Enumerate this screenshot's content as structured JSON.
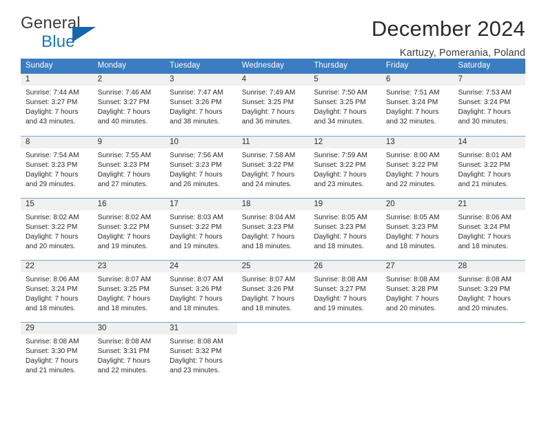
{
  "brand": {
    "name_part1": "General",
    "name_part2": "Blue",
    "triangle_color": "#1566ac",
    "blue_color": "#1878be"
  },
  "header": {
    "title": "December 2024",
    "subtitle": "Kartuzy, Pomerania, Poland"
  },
  "calendar": {
    "header_bg": "#3b7dc0",
    "header_text_color": "#ffffff",
    "daynumber_band_bg": "#f0f0f0",
    "row_separator_color": "#7aa3cf",
    "weekdays": [
      "Sunday",
      "Monday",
      "Tuesday",
      "Wednesday",
      "Thursday",
      "Friday",
      "Saturday"
    ],
    "weeks": [
      [
        {
          "day": "1",
          "sunrise": "Sunrise: 7:44 AM",
          "sunset": "Sunset: 3:27 PM",
          "daylight_line1": "Daylight: 7 hours",
          "daylight_line2": "and 43 minutes."
        },
        {
          "day": "2",
          "sunrise": "Sunrise: 7:46 AM",
          "sunset": "Sunset: 3:27 PM",
          "daylight_line1": "Daylight: 7 hours",
          "daylight_line2": "and 40 minutes."
        },
        {
          "day": "3",
          "sunrise": "Sunrise: 7:47 AM",
          "sunset": "Sunset: 3:26 PM",
          "daylight_line1": "Daylight: 7 hours",
          "daylight_line2": "and 38 minutes."
        },
        {
          "day": "4",
          "sunrise": "Sunrise: 7:49 AM",
          "sunset": "Sunset: 3:25 PM",
          "daylight_line1": "Daylight: 7 hours",
          "daylight_line2": "and 36 minutes."
        },
        {
          "day": "5",
          "sunrise": "Sunrise: 7:50 AM",
          "sunset": "Sunset: 3:25 PM",
          "daylight_line1": "Daylight: 7 hours",
          "daylight_line2": "and 34 minutes."
        },
        {
          "day": "6",
          "sunrise": "Sunrise: 7:51 AM",
          "sunset": "Sunset: 3:24 PM",
          "daylight_line1": "Daylight: 7 hours",
          "daylight_line2": "and 32 minutes."
        },
        {
          "day": "7",
          "sunrise": "Sunrise: 7:53 AM",
          "sunset": "Sunset: 3:24 PM",
          "daylight_line1": "Daylight: 7 hours",
          "daylight_line2": "and 30 minutes."
        }
      ],
      [
        {
          "day": "8",
          "sunrise": "Sunrise: 7:54 AM",
          "sunset": "Sunset: 3:23 PM",
          "daylight_line1": "Daylight: 7 hours",
          "daylight_line2": "and 29 minutes."
        },
        {
          "day": "9",
          "sunrise": "Sunrise: 7:55 AM",
          "sunset": "Sunset: 3:23 PM",
          "daylight_line1": "Daylight: 7 hours",
          "daylight_line2": "and 27 minutes."
        },
        {
          "day": "10",
          "sunrise": "Sunrise: 7:56 AM",
          "sunset": "Sunset: 3:23 PM",
          "daylight_line1": "Daylight: 7 hours",
          "daylight_line2": "and 26 minutes."
        },
        {
          "day": "11",
          "sunrise": "Sunrise: 7:58 AM",
          "sunset": "Sunset: 3:22 PM",
          "daylight_line1": "Daylight: 7 hours",
          "daylight_line2": "and 24 minutes."
        },
        {
          "day": "12",
          "sunrise": "Sunrise: 7:59 AM",
          "sunset": "Sunset: 3:22 PM",
          "daylight_line1": "Daylight: 7 hours",
          "daylight_line2": "and 23 minutes."
        },
        {
          "day": "13",
          "sunrise": "Sunrise: 8:00 AM",
          "sunset": "Sunset: 3:22 PM",
          "daylight_line1": "Daylight: 7 hours",
          "daylight_line2": "and 22 minutes."
        },
        {
          "day": "14",
          "sunrise": "Sunrise: 8:01 AM",
          "sunset": "Sunset: 3:22 PM",
          "daylight_line1": "Daylight: 7 hours",
          "daylight_line2": "and 21 minutes."
        }
      ],
      [
        {
          "day": "15",
          "sunrise": "Sunrise: 8:02 AM",
          "sunset": "Sunset: 3:22 PM",
          "daylight_line1": "Daylight: 7 hours",
          "daylight_line2": "and 20 minutes."
        },
        {
          "day": "16",
          "sunrise": "Sunrise: 8:02 AM",
          "sunset": "Sunset: 3:22 PM",
          "daylight_line1": "Daylight: 7 hours",
          "daylight_line2": "and 19 minutes."
        },
        {
          "day": "17",
          "sunrise": "Sunrise: 8:03 AM",
          "sunset": "Sunset: 3:22 PM",
          "daylight_line1": "Daylight: 7 hours",
          "daylight_line2": "and 19 minutes."
        },
        {
          "day": "18",
          "sunrise": "Sunrise: 8:04 AM",
          "sunset": "Sunset: 3:23 PM",
          "daylight_line1": "Daylight: 7 hours",
          "daylight_line2": "and 18 minutes."
        },
        {
          "day": "19",
          "sunrise": "Sunrise: 8:05 AM",
          "sunset": "Sunset: 3:23 PM",
          "daylight_line1": "Daylight: 7 hours",
          "daylight_line2": "and 18 minutes."
        },
        {
          "day": "20",
          "sunrise": "Sunrise: 8:05 AM",
          "sunset": "Sunset: 3:23 PM",
          "daylight_line1": "Daylight: 7 hours",
          "daylight_line2": "and 18 minutes."
        },
        {
          "day": "21",
          "sunrise": "Sunrise: 8:06 AM",
          "sunset": "Sunset: 3:24 PM",
          "daylight_line1": "Daylight: 7 hours",
          "daylight_line2": "and 18 minutes."
        }
      ],
      [
        {
          "day": "22",
          "sunrise": "Sunrise: 8:06 AM",
          "sunset": "Sunset: 3:24 PM",
          "daylight_line1": "Daylight: 7 hours",
          "daylight_line2": "and 18 minutes."
        },
        {
          "day": "23",
          "sunrise": "Sunrise: 8:07 AM",
          "sunset": "Sunset: 3:25 PM",
          "daylight_line1": "Daylight: 7 hours",
          "daylight_line2": "and 18 minutes."
        },
        {
          "day": "24",
          "sunrise": "Sunrise: 8:07 AM",
          "sunset": "Sunset: 3:26 PM",
          "daylight_line1": "Daylight: 7 hours",
          "daylight_line2": "and 18 minutes."
        },
        {
          "day": "25",
          "sunrise": "Sunrise: 8:07 AM",
          "sunset": "Sunset: 3:26 PM",
          "daylight_line1": "Daylight: 7 hours",
          "daylight_line2": "and 18 minutes."
        },
        {
          "day": "26",
          "sunrise": "Sunrise: 8:08 AM",
          "sunset": "Sunset: 3:27 PM",
          "daylight_line1": "Daylight: 7 hours",
          "daylight_line2": "and 19 minutes."
        },
        {
          "day": "27",
          "sunrise": "Sunrise: 8:08 AM",
          "sunset": "Sunset: 3:28 PM",
          "daylight_line1": "Daylight: 7 hours",
          "daylight_line2": "and 20 minutes."
        },
        {
          "day": "28",
          "sunrise": "Sunrise: 8:08 AM",
          "sunset": "Sunset: 3:29 PM",
          "daylight_line1": "Daylight: 7 hours",
          "daylight_line2": "and 20 minutes."
        }
      ],
      [
        {
          "day": "29",
          "sunrise": "Sunrise: 8:08 AM",
          "sunset": "Sunset: 3:30 PM",
          "daylight_line1": "Daylight: 7 hours",
          "daylight_line2": "and 21 minutes."
        },
        {
          "day": "30",
          "sunrise": "Sunrise: 8:08 AM",
          "sunset": "Sunset: 3:31 PM",
          "daylight_line1": "Daylight: 7 hours",
          "daylight_line2": "and 22 minutes."
        },
        {
          "day": "31",
          "sunrise": "Sunrise: 8:08 AM",
          "sunset": "Sunset: 3:32 PM",
          "daylight_line1": "Daylight: 7 hours",
          "daylight_line2": "and 23 minutes."
        },
        {
          "day": "",
          "sunrise": "",
          "sunset": "",
          "daylight_line1": "",
          "daylight_line2": ""
        },
        {
          "day": "",
          "sunrise": "",
          "sunset": "",
          "daylight_line1": "",
          "daylight_line2": ""
        },
        {
          "day": "",
          "sunrise": "",
          "sunset": "",
          "daylight_line1": "",
          "daylight_line2": ""
        },
        {
          "day": "",
          "sunrise": "",
          "sunset": "",
          "daylight_line1": "",
          "daylight_line2": ""
        }
      ]
    ]
  }
}
